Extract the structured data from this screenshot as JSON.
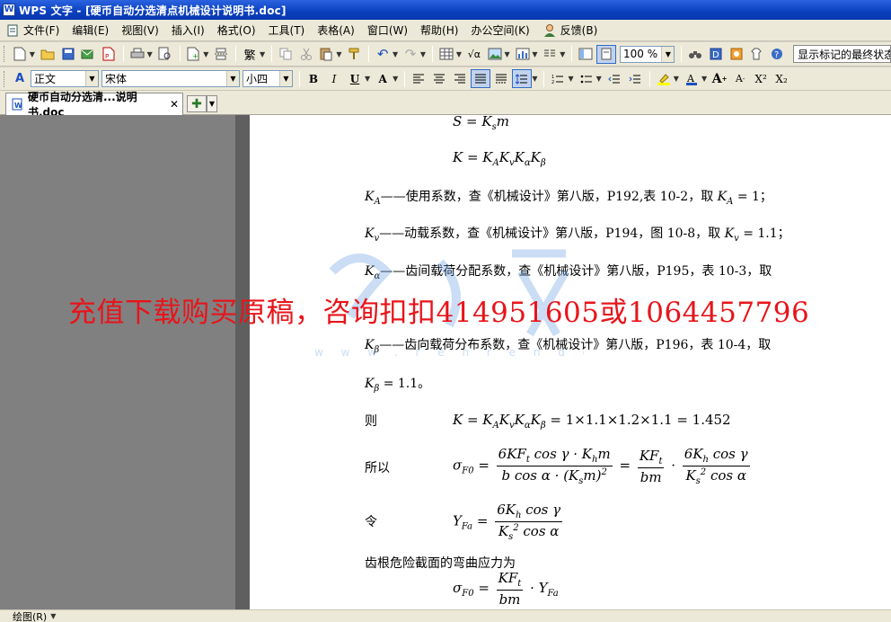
{
  "window": {
    "title": "WPS 文字 - [硬币自动分选清点机械设计说明书.doc]"
  },
  "menu": [
    {
      "label": "文件(F)"
    },
    {
      "label": "编辑(E)"
    },
    {
      "label": "视图(V)"
    },
    {
      "label": "插入(I)"
    },
    {
      "label": "格式(O)"
    },
    {
      "label": "工具(T)"
    },
    {
      "label": "表格(A)"
    },
    {
      "label": "窗口(W)"
    },
    {
      "label": "帮助(H)"
    },
    {
      "label": "办公空间(K)"
    },
    {
      "label": "反馈(B)"
    }
  ],
  "toolbar": {
    "zoom": "100 %",
    "markup_view": "显示标记的最终状态"
  },
  "format": {
    "style": "正文",
    "font": "宋体",
    "size": "小四",
    "bold": "B",
    "italic": "I",
    "underline": "U",
    "superscript": "X²",
    "subscript": "X₂"
  },
  "tab": {
    "label": "硬币自动分选清...说明书.doc"
  },
  "doc": {
    "line1_desc": "——使用系数，查《机械设计》第八版，P192,表 10-2，取",
    "line1_val": "= 1；",
    "line2_desc": "——动载系数，查《机械设计》第八版，P194，图 10-8，取",
    "line2_val": "= 1.1；",
    "line3_desc": "——齿间载荷分配系数，查《机械设计》第八版，P195，表 10-3，取",
    "line4_desc": "——齿向载荷分布系数，查《机械设计》第八版，P196，表 10-4，取",
    "line5_val": "= 1.1。",
    "label_ze": "则",
    "calc": "= 1×1.1×1.2×1.1 = 1.452",
    "label_suoyi": "所以",
    "label_ling": "令",
    "stress_text": "齿根危险截面的弯曲应力为"
  },
  "watermark": {
    "text": "充值下载购买原稿，咨询扣扣414951605或1064457796"
  },
  "status": {
    "draw_label": "绘图(R)"
  },
  "colors": {
    "titlebar": "#0a3fbd",
    "watermark": "#e8141a",
    "workspace": "#808080"
  }
}
